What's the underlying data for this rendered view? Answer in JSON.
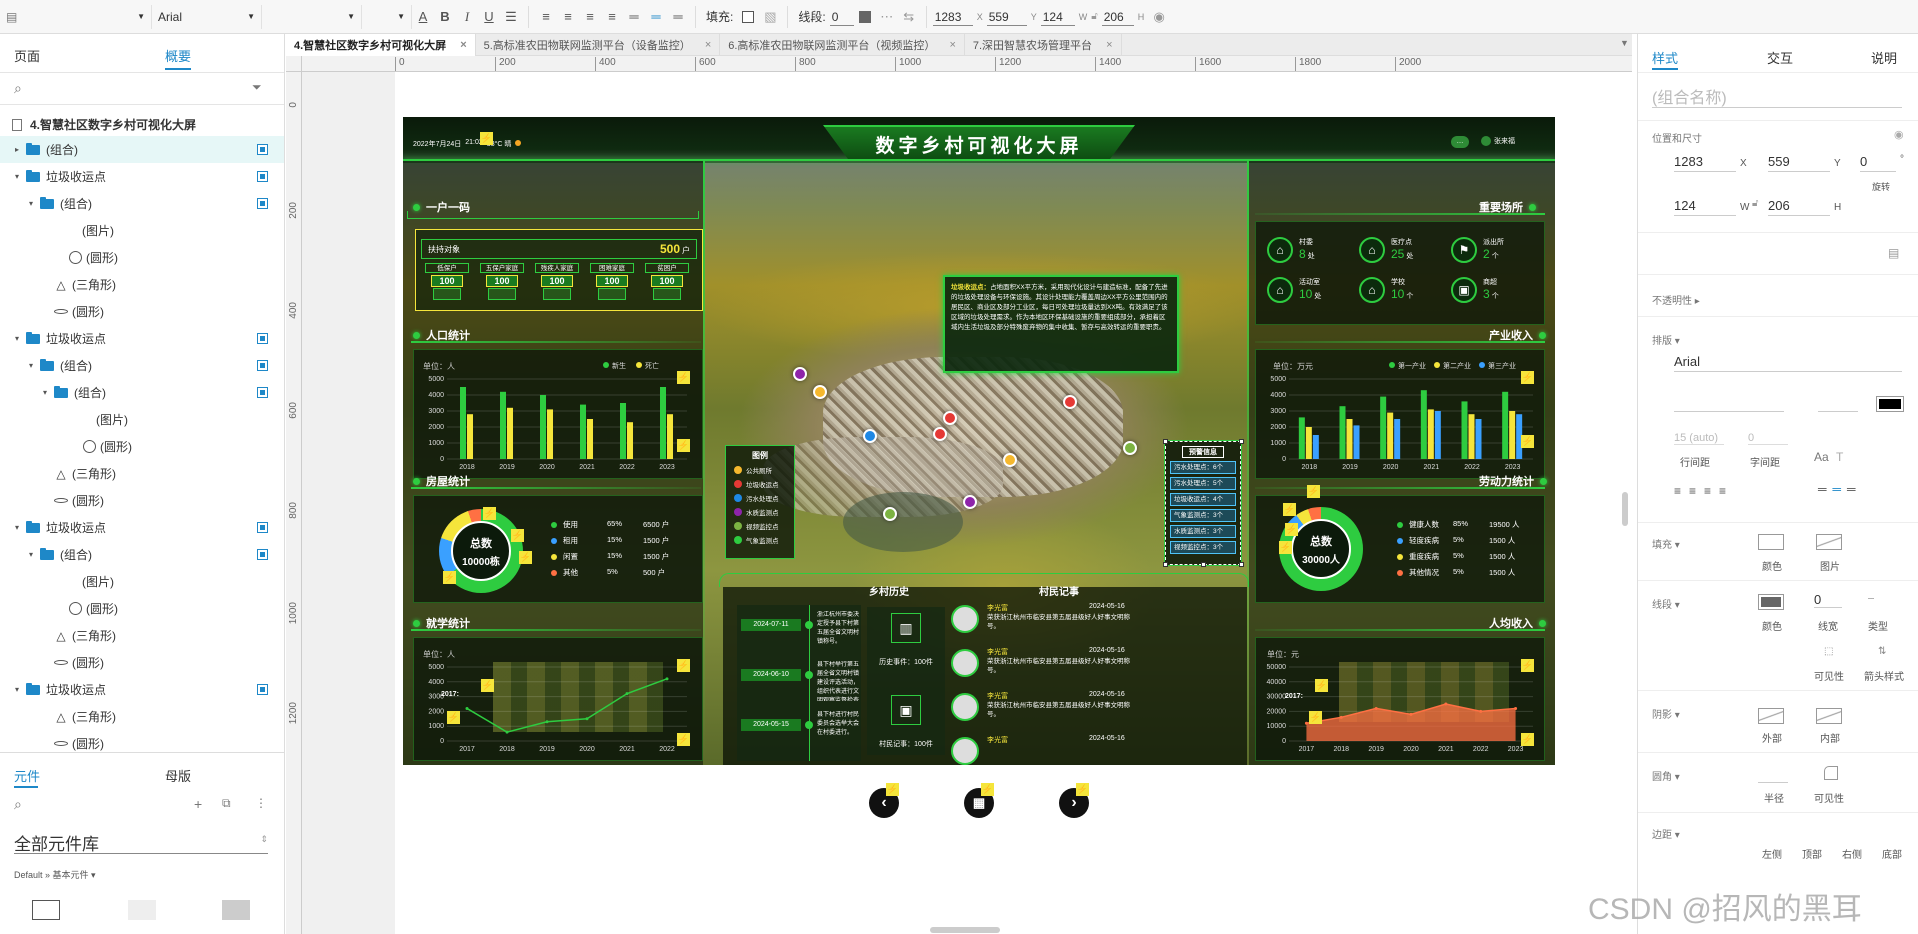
{
  "toolbar": {
    "style_select": "",
    "font": "Arial",
    "weight_select": "",
    "size_select": "",
    "fill_label": "填充:",
    "line_label": "线段:",
    "line_value": "0",
    "x_value": "1283",
    "x_label": "X",
    "y_value": "559",
    "y_label": "Y",
    "w_value": "124",
    "w_label": "W",
    "h_value": "206",
    "h_label": "H"
  },
  "left": {
    "tab_pages": "页面",
    "tab_outline": "概要",
    "page_title": "4.智慧社区数字乡村可视化大屏",
    "tree": [
      {
        "label": "(组合)",
        "indent": 1,
        "type": "folder",
        "caret": "▸",
        "check": true,
        "sel": true
      },
      {
        "label": "垃圾收运点",
        "indent": 1,
        "type": "folder",
        "caret": "▾",
        "check": true
      },
      {
        "label": "(组合)",
        "indent": 2,
        "type": "folder",
        "caret": "▾",
        "check": true
      },
      {
        "label": "(图片)",
        "indent": 4,
        "type": "none"
      },
      {
        "label": "(圆形)",
        "indent": 4,
        "type": "circle"
      },
      {
        "label": "(三角形)",
        "indent": 3,
        "type": "triangle"
      },
      {
        "label": "(圆形)",
        "indent": 3,
        "type": "ellipse"
      },
      {
        "label": "垃圾收运点",
        "indent": 1,
        "type": "folder",
        "caret": "▾",
        "check": true
      },
      {
        "label": "(组合)",
        "indent": 2,
        "type": "folder",
        "caret": "▾",
        "check": true
      },
      {
        "label": "(组合)",
        "indent": 3,
        "type": "folder",
        "caret": "▾",
        "check": true
      },
      {
        "label": "(图片)",
        "indent": 5,
        "type": "none"
      },
      {
        "label": "(圆形)",
        "indent": 5,
        "type": "circle"
      },
      {
        "label": "(三角形)",
        "indent": 3,
        "type": "triangle"
      },
      {
        "label": "(圆形)",
        "indent": 3,
        "type": "ellipse"
      },
      {
        "label": "垃圾收运点",
        "indent": 1,
        "type": "folder",
        "caret": "▾",
        "check": true
      },
      {
        "label": "(组合)",
        "indent": 2,
        "type": "folder",
        "caret": "▾",
        "check": true
      },
      {
        "label": "(图片)",
        "indent": 4,
        "type": "none"
      },
      {
        "label": "(圆形)",
        "indent": 4,
        "type": "circle"
      },
      {
        "label": "(三角形)",
        "indent": 3,
        "type": "triangle"
      },
      {
        "label": "(圆形)",
        "indent": 3,
        "type": "ellipse"
      },
      {
        "label": "垃圾收运点",
        "indent": 1,
        "type": "folder",
        "caret": "▾",
        "check": true
      },
      {
        "label": "(三角形)",
        "indent": 3,
        "type": "triangle"
      },
      {
        "label": "(圆形)",
        "indent": 3,
        "type": "ellipse"
      }
    ],
    "tab_components": "元件",
    "tab_masters": "母版",
    "library": "全部元件库",
    "library_path": "Default » 基本元件 ▾"
  },
  "tabs": [
    {
      "label": "4.智慧社区数字乡村可视化大屏",
      "active": true
    },
    {
      "label": "5.高标准农田物联网监测平台（设备监控）"
    },
    {
      "label": "6.高标准农田物联网监测平台（视频监控）"
    },
    {
      "label": "7.深田智慧农场管理平台"
    }
  ],
  "ruler": [
    "0",
    "200",
    "400",
    "600",
    "800",
    "1000",
    "1200",
    "1400",
    "1600",
    "1800",
    "2000"
  ],
  "ruler_v": [
    "0",
    "200",
    "400",
    "600",
    "800",
    "1000",
    "1200"
  ],
  "dash": {
    "title": "数字乡村可视化大屏",
    "datetime": "2022年7月24日",
    "time": "21:02",
    "weather": "38°C 晴",
    "user": "张来福",
    "one_household": {
      "title": "一户一码",
      "target_label": "扶持对象",
      "target_value": "500",
      "target_unit": "户",
      "cats": [
        {
          "name": "低保户",
          "value": "100"
        },
        {
          "name": "五保户家庭",
          "value": "100"
        },
        {
          "name": "残疾人家庭",
          "value": "100"
        },
        {
          "name": "困难家庭",
          "value": "100"
        },
        {
          "name": "贫困户",
          "value": "100"
        }
      ]
    },
    "population": {
      "title": "人口统计",
      "unit": "单位：人",
      "legend": [
        "新生",
        "死亡"
      ]
    },
    "housing": {
      "title": "房屋统计",
      "total_label": "总数",
      "total_value": "10000栋",
      "rows": [
        {
          "name": "使用",
          "pct": "65%",
          "value": "6500 户",
          "color": "#2ecc40"
        },
        {
          "name": "租用",
          "pct": "15%",
          "value": "1500 户",
          "color": "#3aa0ff"
        },
        {
          "name": "闲置",
          "pct": "15%",
          "value": "1500 户",
          "color": "#f5e53b"
        },
        {
          "name": "其他",
          "pct": "5%",
          "value": "500 户",
          "color": "#ff7043"
        }
      ]
    },
    "education": {
      "title": "就学统计",
      "unit": "单位：人",
      "tooltip_year": "2017:",
      "years": [
        "2017",
        "2018",
        "2019",
        "2020",
        "2021",
        "2022"
      ]
    },
    "places": {
      "title": "重要场所",
      "items": [
        {
          "name": "村委",
          "value": "8",
          "unit": "处"
        },
        {
          "name": "医疗点",
          "value": "25",
          "unit": "处"
        },
        {
          "name": "派出所",
          "value": "2",
          "unit": "个"
        },
        {
          "name": "活动室",
          "value": "10",
          "unit": "处"
        },
        {
          "name": "学校",
          "value": "10",
          "unit": "个"
        },
        {
          "name": "商超",
          "value": "3",
          "unit": "个"
        }
      ]
    },
    "industry": {
      "title": "产业收入",
      "unit": "单位：万元",
      "legend": [
        "第一产业",
        "第二产业",
        "第三产业"
      ]
    },
    "labor": {
      "title": "劳动力统计",
      "total_label": "总数",
      "total_value": "30000人",
      "rows": [
        {
          "name": "健康人数",
          "pct": "85%",
          "value": "19500 人",
          "color": "#2ecc40"
        },
        {
          "name": "轻度疾病",
          "pct": "5%",
          "value": "1500 人",
          "color": "#3aa0ff"
        },
        {
          "name": "重度疾病",
          "pct": "5%",
          "value": "1500 人",
          "color": "#f5e53b"
        },
        {
          "name": "其他情况",
          "pct": "5%",
          "value": "1500 人",
          "color": "#ff7043"
        }
      ]
    },
    "income": {
      "title": "人均收入",
      "unit": "单位：元",
      "tooltip_year": "2017:",
      "years": [
        "2017",
        "2018",
        "2019",
        "2020",
        "2021",
        "2022",
        "2023"
      ]
    },
    "popup": {
      "title": "垃圾收运点：",
      "body": "占地面积XX平方米，采用现代化设计与建造标准，配备了先进的垃圾处理设备与环保设施。其设计处理能力覆盖周边XX平方公里范围内的居民区、商业区及部分工业区，每日可处理垃圾量达到XX吨。有效满足了该区域的垃圾处理需求。作为本地区环保基础设施的重要组成部分，承担着区域内生活垃圾及部分特殊废弃物的集中收集、暂存与高效转运的重要职责。"
    },
    "legend": {
      "title": "图例",
      "items": [
        {
          "name": "公共厕所",
          "color": "#f5b82e"
        },
        {
          "name": "垃圾收运点",
          "color": "#e53935"
        },
        {
          "name": "污水处理点",
          "color": "#1e88e5"
        },
        {
          "name": "水质监测点",
          "color": "#8e24aa"
        },
        {
          "name": "视频监控点",
          "color": "#7cb342"
        },
        {
          "name": "气象监测点",
          "color": "#2ecc40"
        }
      ]
    },
    "warning": {
      "title": "预警信息",
      "items": [
        "污水处理点：6个",
        "污水处理点：5个",
        "垃圾收运点：4个",
        "气象监测点：3个",
        "水质监测点：3个",
        "视频监控点：3个"
      ]
    },
    "history": {
      "title": "乡村历史",
      "items": [
        {
          "date": "2024-07-11",
          "text": "浙江杭州市委决定授予县下村第五届全省文明村镇称号。"
        },
        {
          "date": "2024-06-10",
          "text": "县下村举行第五届全省文明村镇建设评选活动，组织代表进行文明观察监督检查工作。"
        },
        {
          "date": "2024-05-15",
          "text": "县下村进行村民委员会选举大会在村委进行。"
        }
      ],
      "event_label": "历史事件：",
      "event_count": "100件",
      "record_label": "村民记事：",
      "record_count": "100件"
    },
    "notes": {
      "title": "村民记事",
      "items": [
        {
          "name": "李光富",
          "date": "2024-05-16",
          "text": "荣获浙江杭州市临安县第五届县级好人好事文明称号。"
        },
        {
          "name": "李光富",
          "date": "2024-05-16",
          "text": "荣获浙江杭州市临安县第五届县级好人好事文明称号。"
        },
        {
          "name": "李光富",
          "date": "2024-05-16",
          "text": "荣获浙江杭州市临安县第五届县级好人好事文明称号。"
        },
        {
          "name": "李光富",
          "date": "2024-05-16",
          "text": ""
        }
      ]
    }
  },
  "chart_data": [
    {
      "type": "bar",
      "title": "人口统计",
      "ylabel": "单位：人",
      "categories": [
        "2018",
        "2019",
        "2020",
        "2021",
        "2022",
        "2023"
      ],
      "ylim": [
        0,
        5000
      ],
      "y_ticks": [
        "5000",
        "4000",
        "3000",
        "2000",
        "1000",
        "0"
      ],
      "series": [
        {
          "name": "新生",
          "color": "#2ecc40",
          "values": [
            4500,
            4200,
            4000,
            3400,
            3500,
            4500
          ]
        },
        {
          "name": "死亡",
          "color": "#f5e53b",
          "values": [
            2800,
            3200,
            3100,
            2500,
            2300,
            2800
          ]
        }
      ]
    },
    {
      "type": "bar",
      "title": "产业收入",
      "ylabel": "单位：万元",
      "categories": [
        "2018",
        "2019",
        "2020",
        "2021",
        "2022",
        "2023"
      ],
      "ylim": [
        0,
        5000
      ],
      "y_ticks": [
        "5000",
        "4000",
        "3000",
        "2000",
        "1000",
        "0"
      ],
      "series": [
        {
          "name": "第一产业",
          "color": "#2ecc40",
          "values": [
            2600,
            3300,
            3900,
            4300,
            3600,
            4200
          ]
        },
        {
          "name": "第二产业",
          "color": "#f5e53b",
          "values": [
            2000,
            2500,
            2900,
            3100,
            2800,
            3000
          ]
        },
        {
          "name": "第三产业",
          "color": "#3aa0ff",
          "values": [
            1500,
            2100,
            2500,
            3000,
            2500,
            2800
          ]
        }
      ]
    },
    {
      "type": "line",
      "title": "就学统计",
      "ylabel": "单位：人",
      "x": [
        "2017",
        "2018",
        "2019",
        "2020",
        "2021",
        "2022"
      ],
      "ylim": [
        0,
        5000
      ],
      "y_ticks": [
        "5000",
        "4000",
        "3000",
        "2000",
        "1000",
        "0"
      ],
      "series": [
        {
          "color": "#2ecc40",
          "values": [
            2200,
            600,
            1300,
            1500,
            3200,
            4200
          ]
        }
      ]
    },
    {
      "type": "area",
      "title": "人均收入",
      "ylabel": "单位：元",
      "x": [
        "2017",
        "2018",
        "2019",
        "2020",
        "2021",
        "2022",
        "2023"
      ],
      "ylim": [
        0,
        50000
      ],
      "y_ticks": [
        "50000",
        "40000",
        "30000",
        "20000",
        "10000",
        "0"
      ],
      "series": [
        {
          "color": "#ff7043",
          "values": [
            12000,
            16000,
            22000,
            18000,
            25000,
            20000,
            22000
          ]
        }
      ]
    }
  ],
  "right": {
    "tab_style": "样式",
    "tab_interact": "交互",
    "tab_notes": "说明",
    "name_placeholder": "(组合名称)",
    "pos_label": "位置和尺寸",
    "x": "1283",
    "x_label": "X",
    "y": "559",
    "y_label": "Y",
    "rot": "0",
    "rot_unit": "°",
    "rot_label": "旋转",
    "w": "124",
    "w_label": "W",
    "h": "206",
    "h_label": "H",
    "opacity_label": "不透明性 ▸",
    "type_label": "排版 ▾",
    "font": "Arial",
    "line_height_ph": "15 (auto)",
    "letter_ph": "0",
    "line_height_label": "行间距",
    "letter_label": "字间距",
    "fill_label": "填充 ▾",
    "fill_color": "颜色",
    "fill_image": "图片",
    "stroke_label": "线段 ▾",
    "stroke_color": "颜色",
    "stroke_width": "线宽",
    "stroke_width_value": "0",
    "stroke_type": "类型",
    "visibility": "可见性",
    "arrow_style": "箭头样式",
    "shadow_label": "阴影 ▾",
    "shadow_outer": "外部",
    "shadow_inner": "内部",
    "corner_label": "圆角 ▾",
    "corner_radius": "半径",
    "corner_vis": "可见性",
    "margin_label": "边距 ▾",
    "margin_left": "左侧",
    "margin_top": "顶部",
    "margin_right": "右侧",
    "margin_bottom": "底部"
  },
  "watermark": "CSDN @招风的黑耳"
}
